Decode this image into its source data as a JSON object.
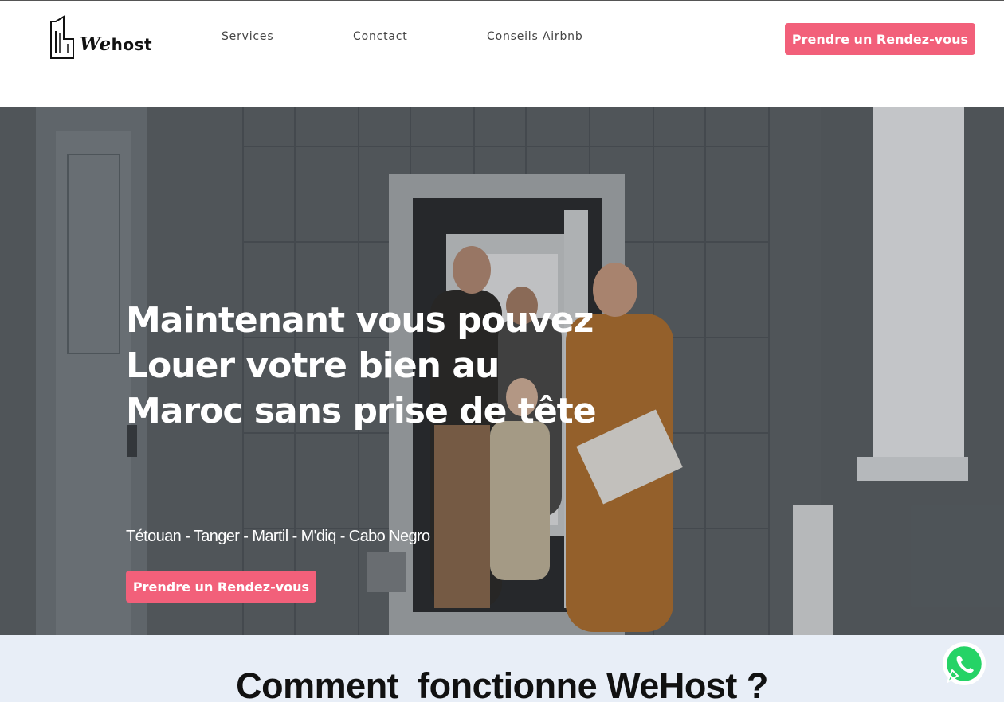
{
  "header": {
    "logo_text_we": "We",
    "logo_text_host": "host",
    "nav": [
      {
        "label": "Services"
      },
      {
        "label": "Conctact"
      },
      {
        "label": "Conseils Airbnb"
      }
    ],
    "cta_label": "Prendre un Rendez-vous"
  },
  "hero": {
    "title_lines": [
      "Maintenant vous pouvez",
      "Louer votre bien au",
      "Maroc sans prise de tête"
    ],
    "cities": "Tétouan - Tanger - Martil - M'diq - Cabo Negro",
    "cta_label": "Prendre un Rendez-vous"
  },
  "how": {
    "title": "Comment  fonctionne WeHost ?"
  },
  "icons": {
    "logo": "building-logo-icon",
    "chat": "whatsapp-icon"
  },
  "colors": {
    "accent": "#f2607a",
    "section_bg": "#e8eef7",
    "whatsapp_green": "#25d366"
  }
}
